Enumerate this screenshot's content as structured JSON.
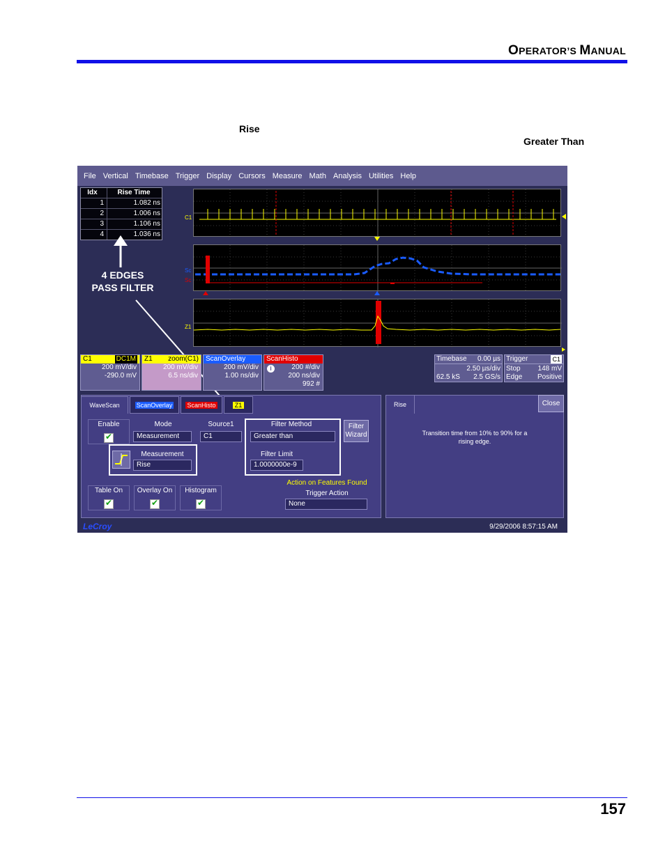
{
  "header": {
    "title_big1": "O",
    "title_small1": "PERATOR",
    "title_apos": "’",
    "title_small2": "S ",
    "title_big2": "M",
    "title_small3": "ANUAL"
  },
  "body_text": {
    "rise": "Rise",
    "greater_than": "Greater Than"
  },
  "footer": {
    "page_number": "157"
  },
  "screenshot": {
    "menu": [
      "File",
      "Vertical",
      "Timebase",
      "Trigger",
      "Display",
      "Cursors",
      "Measure",
      "Math",
      "Analysis",
      "Utilities",
      "Help"
    ],
    "table": {
      "headers": [
        "Idx",
        "Rise Time"
      ],
      "rows": [
        [
          "1",
          "1.082 ns"
        ],
        [
          "2",
          "1.006 ns"
        ],
        [
          "3",
          "1.106 ns"
        ],
        [
          "4",
          "1.036 ns"
        ]
      ]
    },
    "annotation": {
      "line1": "4 EDGES",
      "line2": "PASS FILTER"
    },
    "trace_labels": {
      "c1": "C1",
      "sc1": "Sc",
      "sc2": "Sc",
      "z1": "Z1"
    },
    "descriptors": {
      "c1": {
        "name": "C1",
        "badge": "DC1M",
        "line1": "200 mV/div",
        "line2": "-290.0 mV"
      },
      "z1": {
        "name": "Z1",
        "label": "zoom(C1)",
        "line1": "200 mV/div",
        "line2": "6.5 ns/div"
      },
      "scanoverlay": {
        "name": "ScanOverlay",
        "line1": "200 mV/div",
        "line2": "1.00 ns/div"
      },
      "scanhisto": {
        "name": "ScanHisto",
        "line1": "200 #/div",
        "line2": "200 ns/div",
        "line3": "992 #"
      },
      "timebase": {
        "name": "Timebase",
        "value": "0.00 µs",
        "line1": "2.50 µs/div",
        "line2a": "62.5 kS",
        "line2b": "2.5 GS/s"
      },
      "trigger": {
        "name": "Trigger",
        "badge": "C1",
        "line1a": "Stop",
        "line1b": "148 mV",
        "line2a": "Edge",
        "line2b": "Positive"
      }
    },
    "tabs": [
      "WaveScan",
      "ScanOverlay",
      "ScanHisto",
      "Z1"
    ],
    "dialog": {
      "enable_label": "Enable",
      "mode_label": "Mode",
      "mode_value": "Measurement",
      "source_label": "Source1",
      "source_value": "C1",
      "filter_method_label": "Filter Method",
      "filter_method_value": "Greater than",
      "filter_wizard": "Filter Wizard",
      "measurement_label": "Measurement",
      "measurement_value": "Rise",
      "filter_limit_label": "Filter Limit",
      "filter_limit_value": "1.0000000e-9",
      "table_on": "Table On",
      "overlay_on": "Overlay On",
      "histogram": "Histogram",
      "action_title": "Action on Features Found",
      "trigger_action_label": "Trigger Action",
      "trigger_action_value": "None"
    },
    "help": {
      "tab": "Rise",
      "close": "Close",
      "text1": "Transition time from 10% to 90% for a",
      "text2": "rising edge."
    },
    "brand": "LeCroy",
    "timestamp": "9/29/2006 8:57:15 AM",
    "colors": {
      "menubar": "#5d5a8e",
      "panel": "#433e83",
      "c1": "#ffff00",
      "z1": "#ffff00",
      "scanoverlay": "#1a5cff",
      "scanhisto": "#e00000",
      "header_rule": "#1010e8"
    }
  }
}
